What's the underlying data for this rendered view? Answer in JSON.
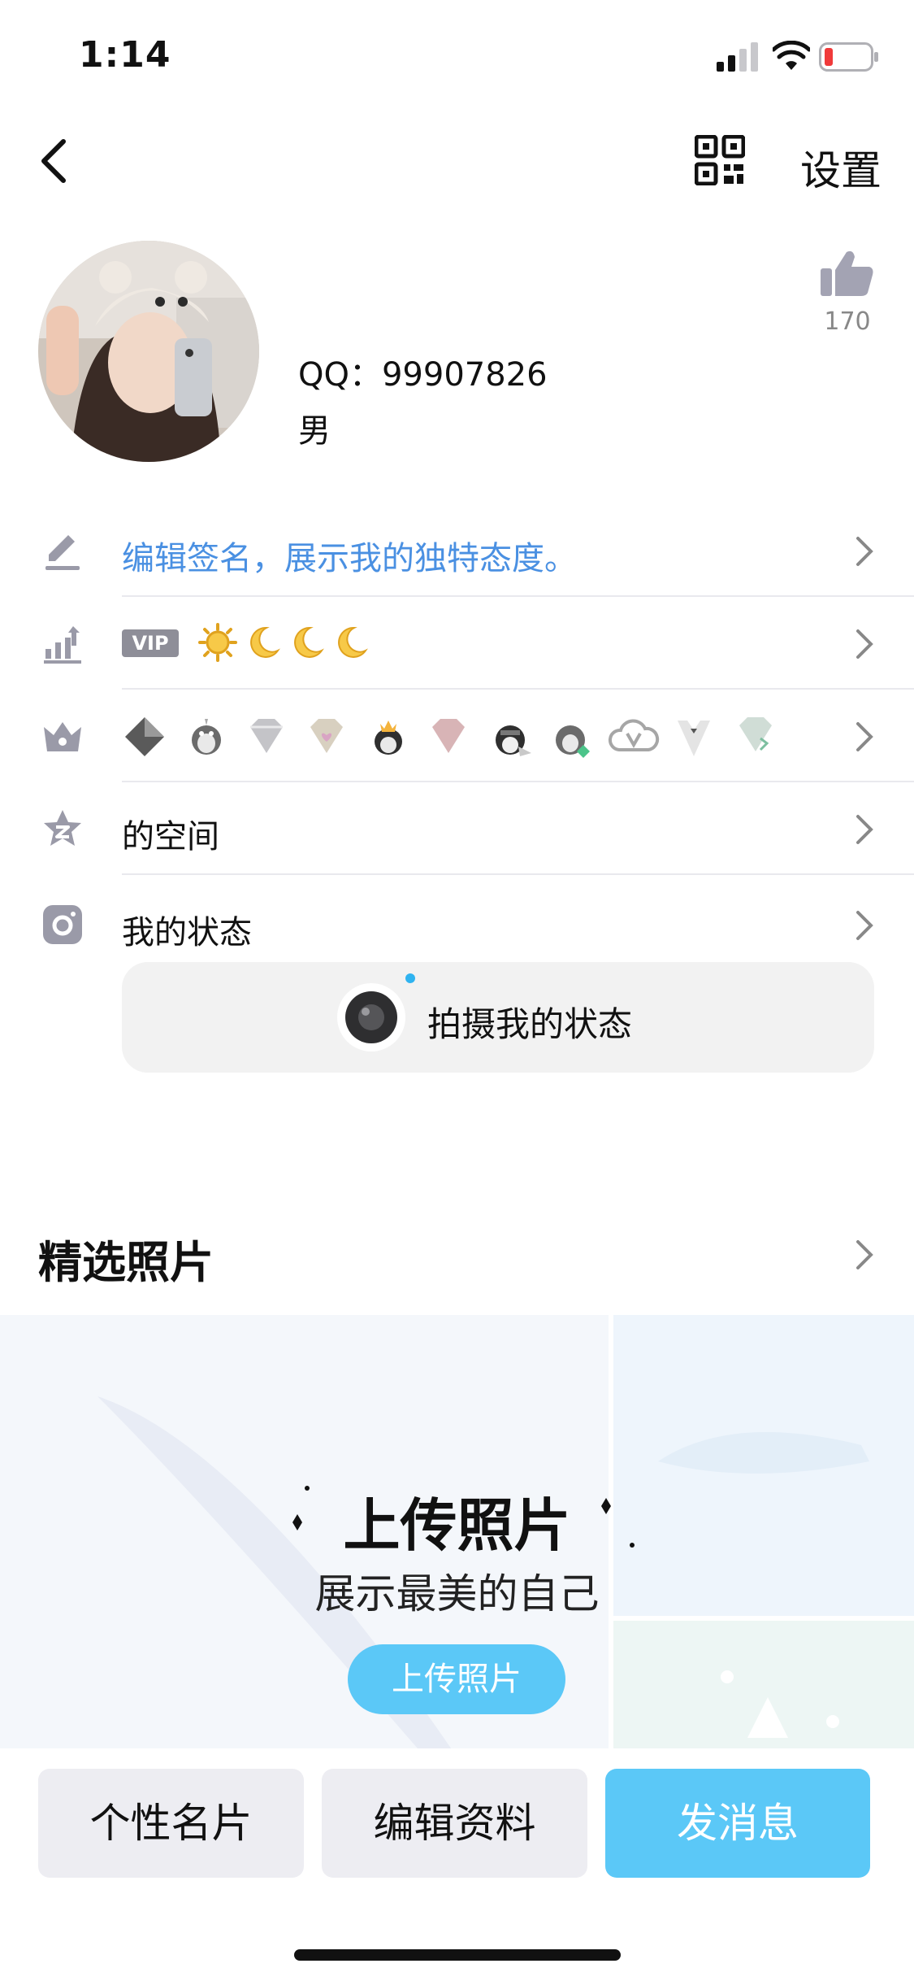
{
  "status_bar": {
    "time": "1:14"
  },
  "nav": {
    "back_icon": "chevron-left-icon",
    "qr_icon": "qr-code-icon",
    "settings_label": "设置"
  },
  "profile": {
    "qq_line": "QQ：99907826",
    "gender": "男",
    "like_count": "170"
  },
  "rows": [
    {
      "icon": "pencil-icon",
      "label": "编辑签名，展示我的独特态度。"
    },
    {
      "icon": "growth-chart-icon",
      "vip_badge": "VIP"
    },
    {
      "icon": "crown-icon"
    },
    {
      "icon": "qzone-star-icon",
      "label": "的空间"
    },
    {
      "icon": "instagram-camera-icon",
      "label": "我的状态"
    }
  ],
  "status_capture": {
    "label": "拍摄我的状态"
  },
  "featured": {
    "title": "精选照片",
    "upload_title": "上传照片",
    "upload_subtitle": "展示最美的自己",
    "upload_button": "上传照片"
  },
  "actions": {
    "card": "个性名片",
    "edit": "编辑资料",
    "message": "发消息"
  },
  "colors": {
    "accent": "#5bc8f7",
    "signature_blue": "#4a90e2",
    "icon_gray": "#9a9aa8"
  }
}
